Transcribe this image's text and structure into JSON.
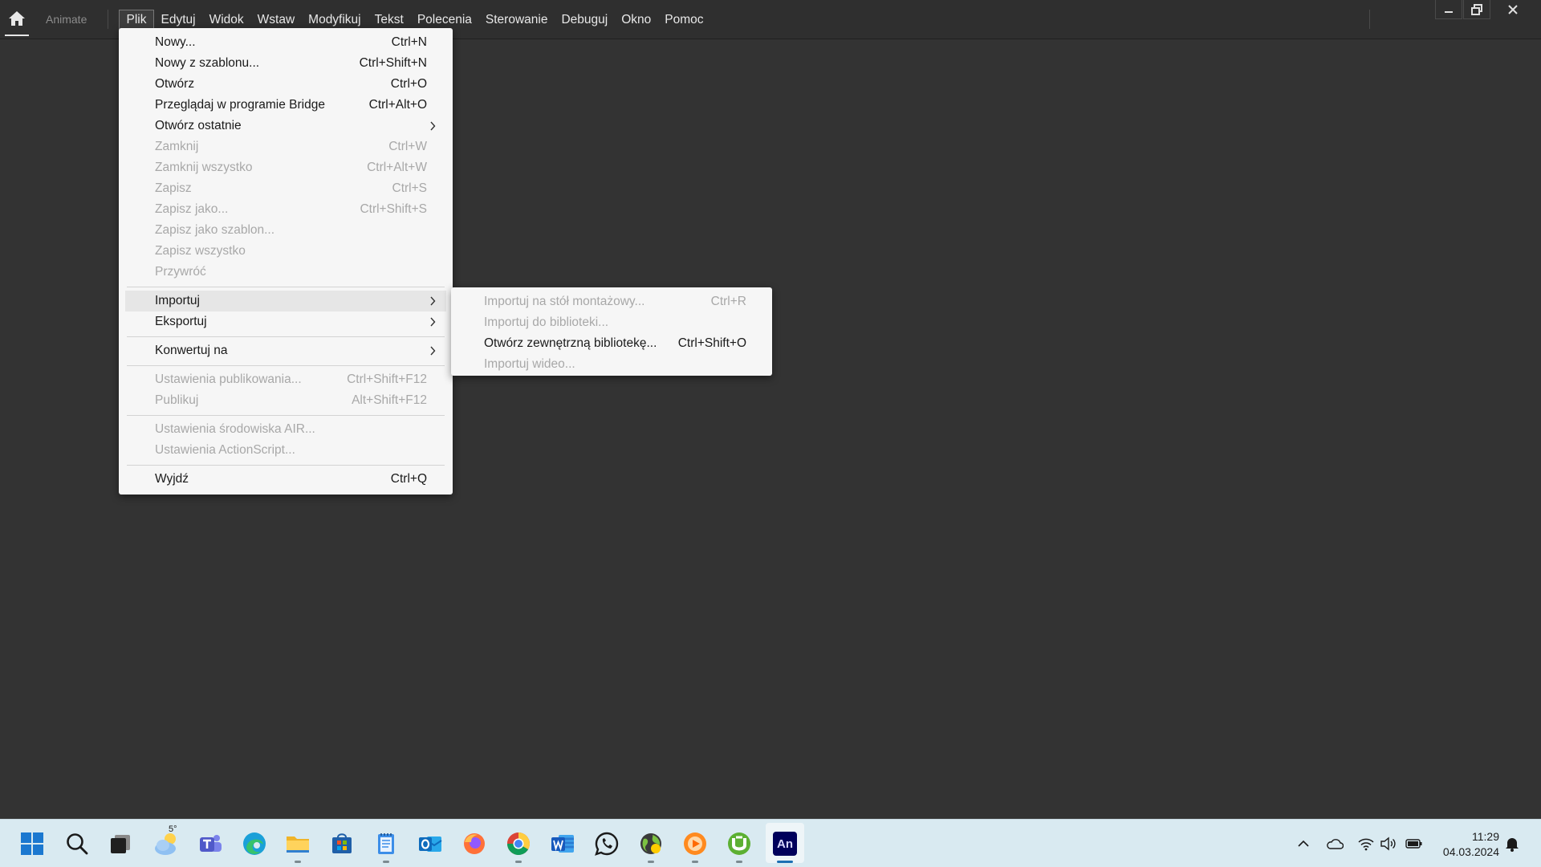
{
  "app": {
    "name": "Animate"
  },
  "menubar": {
    "items": [
      {
        "label": "Plik"
      },
      {
        "label": "Edytuj"
      },
      {
        "label": "Widok"
      },
      {
        "label": "Wstaw"
      },
      {
        "label": "Modyfikuj"
      },
      {
        "label": "Tekst"
      },
      {
        "label": "Polecenia"
      },
      {
        "label": "Sterowanie"
      },
      {
        "label": "Debuguj"
      },
      {
        "label": "Okno"
      },
      {
        "label": "Pomoc"
      }
    ],
    "active": "Plik"
  },
  "file_menu": {
    "items": [
      {
        "label": "Nowy...",
        "shortcut": "Ctrl+N"
      },
      {
        "label": "Nowy z szablonu...",
        "shortcut": "Ctrl+Shift+N"
      },
      {
        "label": "Otwórz",
        "shortcut": "Ctrl+O"
      },
      {
        "label": "Przeglądaj w programie Bridge",
        "shortcut": "Ctrl+Alt+O"
      },
      {
        "label": "Otwórz ostatnie",
        "shortcut": ""
      },
      {
        "label": "Zamknij",
        "shortcut": "Ctrl+W"
      },
      {
        "label": "Zamknij wszystko",
        "shortcut": "Ctrl+Alt+W"
      },
      {
        "label": "Zapisz",
        "shortcut": "Ctrl+S"
      },
      {
        "label": "Zapisz jako...",
        "shortcut": "Ctrl+Shift+S"
      },
      {
        "label": "Zapisz jako szablon...",
        "shortcut": ""
      },
      {
        "label": "Zapisz wszystko",
        "shortcut": ""
      },
      {
        "label": "Przywróć",
        "shortcut": ""
      },
      {
        "label": "Importuj",
        "shortcut": ""
      },
      {
        "label": "Eksportuj",
        "shortcut": ""
      },
      {
        "label": "Konwertuj na",
        "shortcut": ""
      },
      {
        "label": "Ustawienia publikowania...",
        "shortcut": "Ctrl+Shift+F12"
      },
      {
        "label": "Publikuj",
        "shortcut": "Alt+Shift+F12"
      },
      {
        "label": "Ustawienia środowiska AIR...",
        "shortcut": ""
      },
      {
        "label": "Ustawienia ActionScript...",
        "shortcut": ""
      },
      {
        "label": "Wyjdź",
        "shortcut": "Ctrl+Q"
      }
    ]
  },
  "import_menu": {
    "items": [
      {
        "label": "Importuj na stół montażowy...",
        "shortcut": "Ctrl+R"
      },
      {
        "label": "Importuj do biblioteki...",
        "shortcut": ""
      },
      {
        "label": "Otwórz zewnętrzną bibliotekę...",
        "shortcut": "Ctrl+Shift+O"
      },
      {
        "label": "Importuj wideo...",
        "shortcut": ""
      }
    ]
  },
  "taskbar": {
    "weather_temp": "5°",
    "icons": [
      "windows-start-icon",
      "search-icon",
      "task-view-icon",
      "weather-icon",
      "teams-icon",
      "edge-icon",
      "file-explorer-icon",
      "microsoft-store-icon",
      "notepad-icon",
      "outlook-icon",
      "firefox-icon",
      "chrome-icon",
      "word-icon",
      "whatsapp-icon",
      "globe-app-icon",
      "media-player-icon",
      "utorrent-icon",
      "animate-icon"
    ],
    "animate_label": "An",
    "time": "11:29",
    "date": "04.03.2024"
  }
}
